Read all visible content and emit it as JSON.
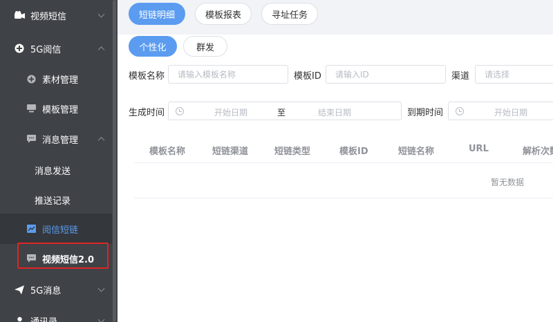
{
  "sidebar": {
    "items": [
      {
        "label": "视频短信",
        "icon": "video-camera-icon"
      },
      {
        "label": "5G阅信",
        "icon": "plus-circle-icon"
      },
      {
        "label": "素材管理",
        "icon": "plus-circle-icon"
      },
      {
        "label": "模板管理",
        "icon": "monitor-icon"
      },
      {
        "label": "消息管理",
        "icon": "chat-icon"
      },
      {
        "label": "消息发送"
      },
      {
        "label": "推送记录"
      },
      {
        "label": "阅信短链",
        "icon": "trend-chart-icon"
      },
      {
        "label": "视频短信2.0",
        "icon": "chat-icon"
      },
      {
        "label": "5G消息",
        "icon": "paper-plane-icon"
      },
      {
        "label": "通讯录",
        "icon": "contacts-icon"
      }
    ],
    "active_color": "#5b9df0",
    "highlight_color": "#e02424"
  },
  "tabs": [
    {
      "label": "短链明细",
      "active": true
    },
    {
      "label": "模板报表",
      "active": false
    },
    {
      "label": "寻址任务",
      "active": false
    }
  ],
  "subtabs": [
    {
      "label": "个性化",
      "active": true
    },
    {
      "label": "群发",
      "active": false
    }
  ],
  "filters": {
    "template_name": {
      "label": "模板名称",
      "placeholder": "请输入模板名称"
    },
    "template_id": {
      "label": "模板ID",
      "placeholder": "请输入ID"
    },
    "channel": {
      "label": "渠道",
      "placeholder": "请选择"
    },
    "created_time": {
      "label": "生成时间",
      "start_placeholder": "开始日期",
      "separator": "至",
      "end_placeholder": "结束日期"
    },
    "expire_time": {
      "label": "到期时间",
      "start_placeholder": "开始日期"
    }
  },
  "table": {
    "columns": [
      "模板名称",
      "短链渠道",
      "短链类型",
      "模板ID",
      "短链名称",
      "URL",
      "解析次数"
    ],
    "empty_text": "暂无数据"
  },
  "colors": {
    "primary": "#5b9cf0",
    "sidebar_bg": "#3f4247"
  }
}
